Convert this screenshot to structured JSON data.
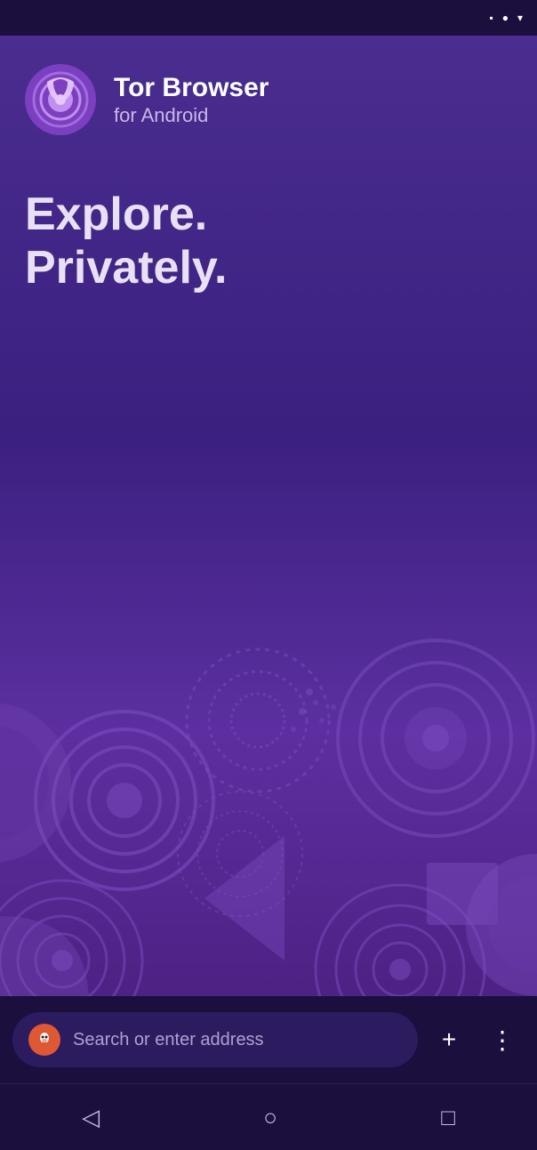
{
  "status_bar": {
    "icons": [
      "stop-icon",
      "circle-icon",
      "wifi-icon"
    ]
  },
  "header": {
    "app_title": "Tor Browser",
    "app_subtitle": "for Android",
    "logo_alt": "Tor Browser Logo"
  },
  "tagline": {
    "line1": "Explore.",
    "line2": "Privately."
  },
  "search_bar": {
    "placeholder": "Search or enter address",
    "duck_icon": "🦆",
    "add_label": "+",
    "more_label": "⋮"
  },
  "nav_bar": {
    "back_label": "◁",
    "home_label": "○",
    "recents_label": "□"
  },
  "colors": {
    "bg_dark": "#1a0f3d",
    "bg_main": "#4a2d8f",
    "accent_purple": "#7c4db8",
    "text_white": "#ffffff",
    "text_muted": "#c8b8e8"
  }
}
